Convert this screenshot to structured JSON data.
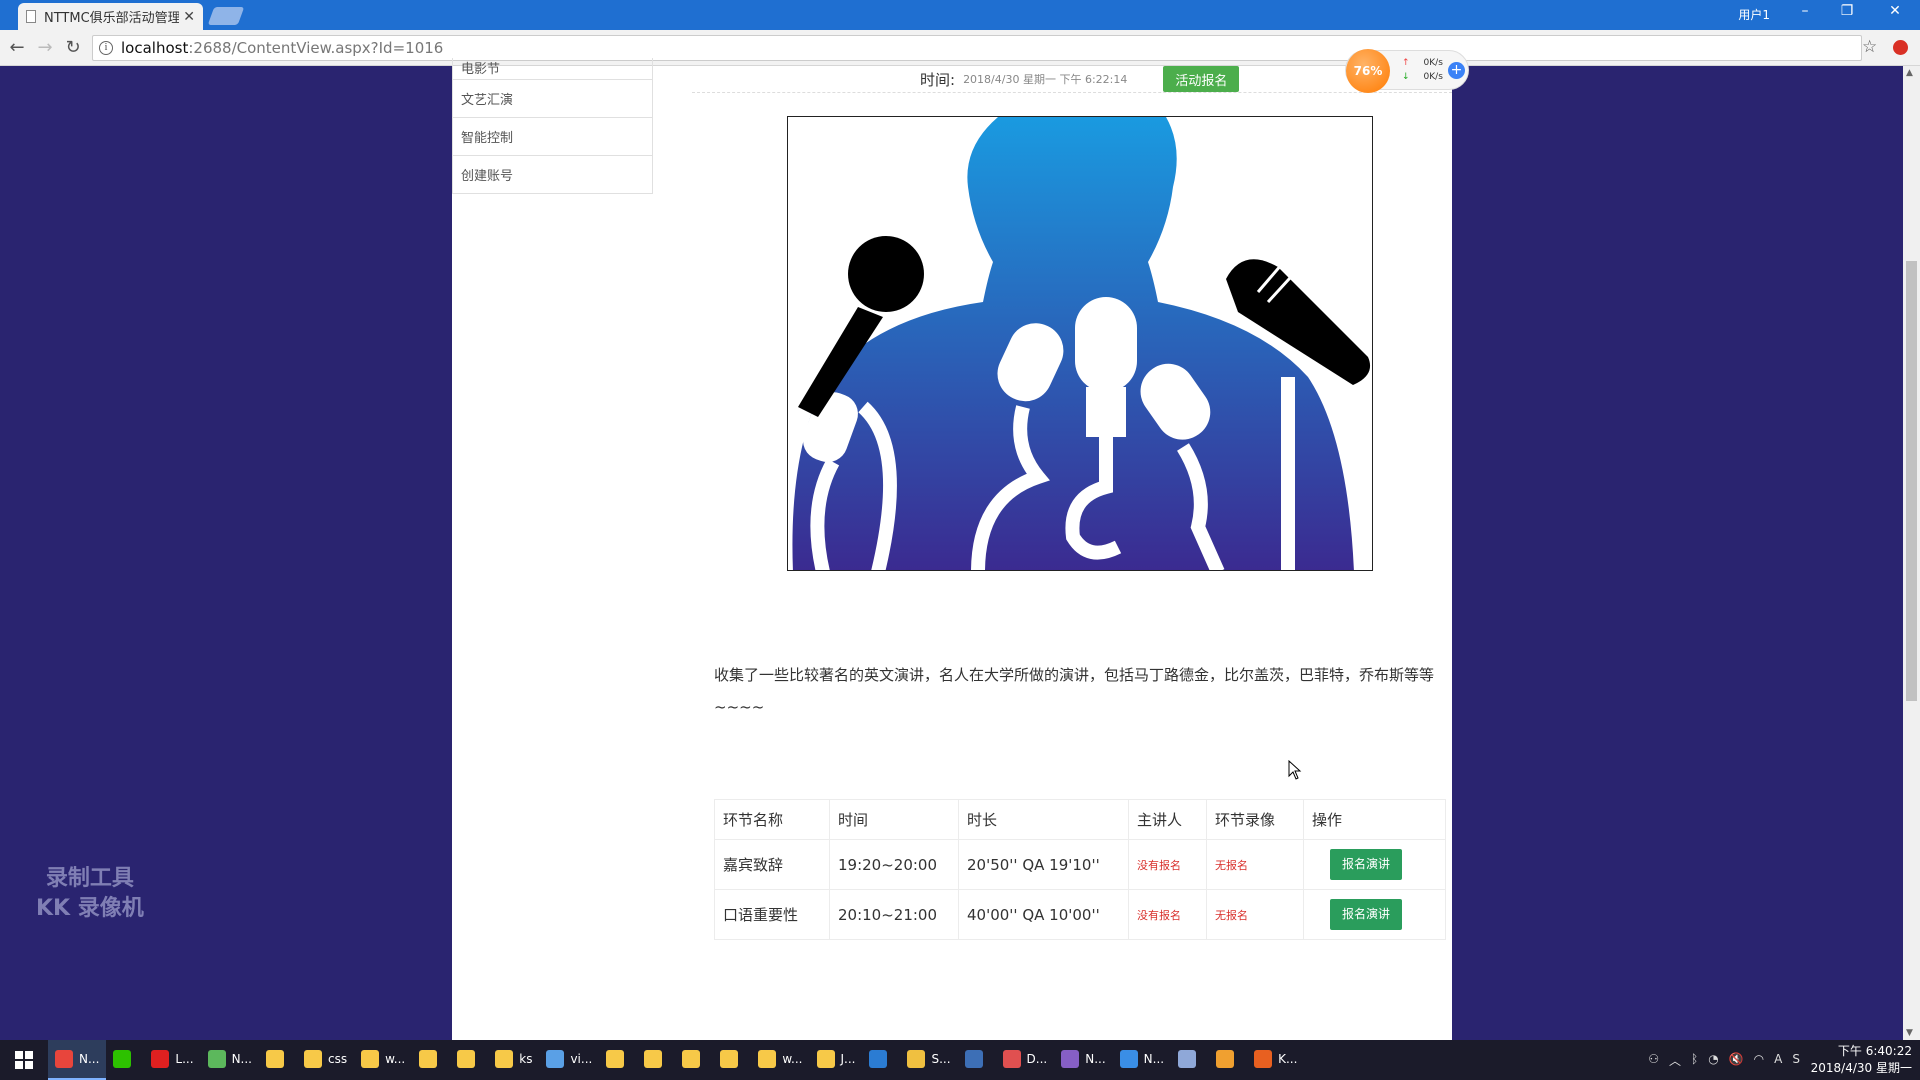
{
  "browser": {
    "tab_title": "NTTMC俱乐部活动管理",
    "tab_close": "✕",
    "user_label": "用户1",
    "url_host": "localhost",
    "url_path": ":2688/ContentView.aspx?Id=1016"
  },
  "sidebar": {
    "items": [
      {
        "label": "电影节"
      },
      {
        "label": "文艺汇演"
      },
      {
        "label": "智能控制"
      },
      {
        "label": "创建账号"
      }
    ]
  },
  "activity": {
    "time_label": "时间:",
    "time_value": "2018/4/30 星期一 下午 6:22:14",
    "signup_label": "活动报名",
    "description": "收集了一些比较著名的英文演讲，名人在大学所做的演讲，包括马丁路德金，比尔盖茨，巴菲特，乔布斯等等~~~~"
  },
  "agenda": {
    "headers": [
      "环节名称",
      "时间",
      "时长",
      "主讲人",
      "环节录像",
      "操作"
    ],
    "rows": [
      {
        "name": "嘉宾致辞",
        "time": "19:20~20:00",
        "duration": "20'50'' QA 19'10''",
        "speaker": "没有报名",
        "video": "无报名",
        "action": "报名演讲"
      },
      {
        "name": "口语重要性",
        "time": "20:10~21:00",
        "duration": "40'00'' QA 10'00''",
        "speaker": "没有报名",
        "video": "无报名",
        "action": "报名演讲"
      }
    ]
  },
  "speed_widget": {
    "percent": "76%",
    "up": "0K/s",
    "down": "0K/s",
    "plus": "+"
  },
  "watermark": {
    "line1": "录制工具",
    "line2": "KK 录像机"
  },
  "taskbar": {
    "items": [
      {
        "label": "N...",
        "icon": "chrome-icon",
        "color": "#e8453c"
      },
      {
        "label": "",
        "icon": "wechat-icon",
        "color": "#2dc100"
      },
      {
        "label": "L...",
        "icon": "netease-icon",
        "color": "#e02020"
      },
      {
        "label": "N...",
        "icon": "qihoo-icon",
        "color": "#5cb85c"
      },
      {
        "label": "",
        "icon": "folder-icon",
        "color": "#f7c948"
      },
      {
        "label": "css",
        "icon": "folder-icon",
        "color": "#f7c948"
      },
      {
        "label": "w...",
        "icon": "folder-icon",
        "color": "#f7c948"
      },
      {
        "label": "",
        "icon": "folder-icon",
        "color": "#f7c948"
      },
      {
        "label": "",
        "icon": "folder-icon",
        "color": "#f7c948"
      },
      {
        "label": "ks",
        "icon": "folder-icon",
        "color": "#f7c948"
      },
      {
        "label": "vi...",
        "icon": "cube-icon",
        "color": "#5aa0e6"
      },
      {
        "label": "",
        "icon": "folder-icon",
        "color": "#f7c948"
      },
      {
        "label": "",
        "icon": "folder-icon",
        "color": "#f7c948"
      },
      {
        "label": "",
        "icon": "folder-icon",
        "color": "#f7c948"
      },
      {
        "label": "",
        "icon": "folder-icon",
        "color": "#f7c948"
      },
      {
        "label": "w...",
        "icon": "folder-icon",
        "color": "#f7c948"
      },
      {
        "label": "J...",
        "icon": "folder-icon",
        "color": "#f7c948"
      },
      {
        "label": "",
        "icon": "word-icon",
        "color": "#2b7cd3"
      },
      {
        "label": "S...",
        "icon": "tools-icon",
        "color": "#f0c040"
      },
      {
        "label": "",
        "icon": "gear-icon",
        "color": "#3d6fb6"
      },
      {
        "label": "D...",
        "icon": "pen-icon",
        "color": "#e05050"
      },
      {
        "label": "N...",
        "icon": "visualstudio-icon",
        "color": "#865fc5"
      },
      {
        "label": "N...",
        "icon": "window-icon",
        "color": "#3a8ee6"
      },
      {
        "label": "",
        "icon": "feather-icon",
        "color": "#8fa8d8"
      },
      {
        "label": "",
        "icon": "audio-icon",
        "color": "#f0a030"
      },
      {
        "label": "K...",
        "icon": "kk-recorder-icon",
        "color": "#e86020"
      }
    ],
    "clock_time": "下午 6:40:22",
    "clock_date": "2018/4/30 星期一"
  }
}
